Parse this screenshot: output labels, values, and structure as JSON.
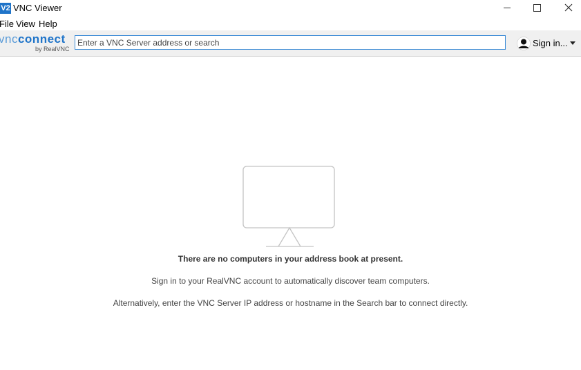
{
  "window": {
    "app_icon_text": "V2",
    "title": "VNC Viewer"
  },
  "menu": {
    "file": "File",
    "view": "View",
    "help": "Help"
  },
  "toolbar": {
    "logo_vnc": "vnc",
    "logo_connect": "connect",
    "logo_by": "by RealVNC",
    "search_value": "",
    "search_placeholder": "Enter a VNC Server address or search",
    "signin_label": "Sign in..."
  },
  "empty_state": {
    "title": "There are no computers in your address book at present.",
    "line1": "Sign in to your RealVNC account to automatically discover team computers.",
    "line2": "Alternatively, enter the VNC Server IP address or hostname in the Search bar to connect directly."
  },
  "colors": {
    "accent": "#1f74c9",
    "search_border": "#3c8bd6",
    "toolbar_bg": "#f0f0f0"
  }
}
